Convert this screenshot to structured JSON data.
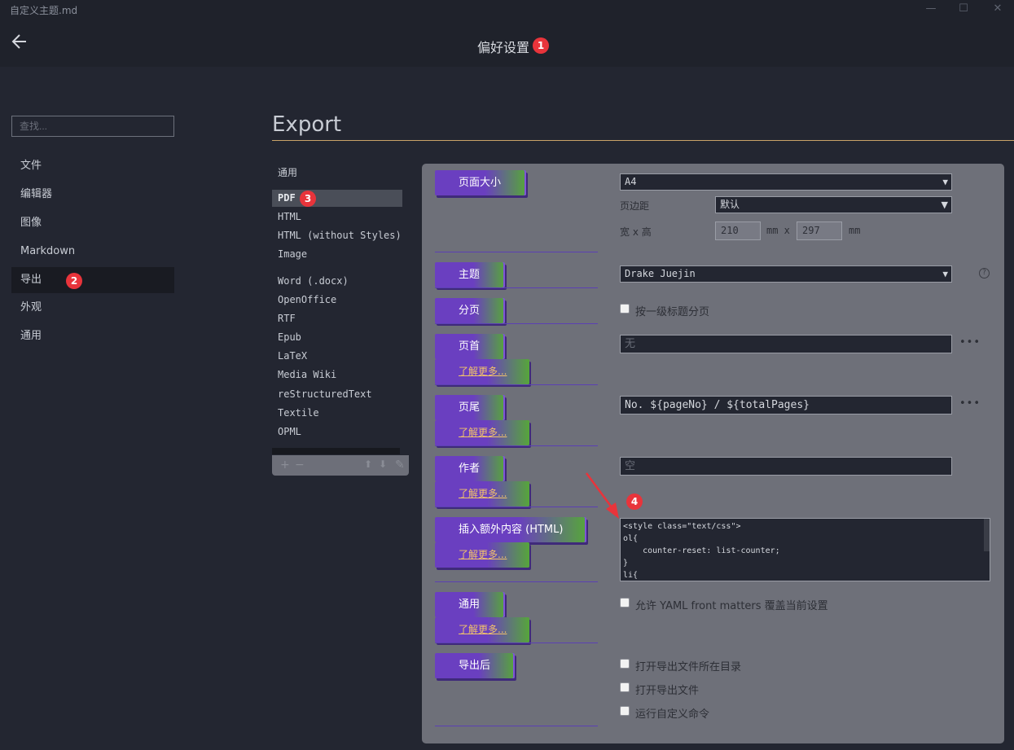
{
  "window": {
    "title": "自定义主题.md",
    "minimize": "—",
    "maximize": "☐",
    "close": "✕"
  },
  "header": {
    "title": "偏好设置"
  },
  "annotations": [
    "1",
    "2",
    "3",
    "4"
  ],
  "sidebar": {
    "search_placeholder": "查找...",
    "items": [
      {
        "label": "文件"
      },
      {
        "label": "编辑器"
      },
      {
        "label": "图像"
      },
      {
        "label": "Markdown"
      },
      {
        "label": "导出",
        "active": true
      },
      {
        "label": "外观"
      },
      {
        "label": "通用"
      }
    ]
  },
  "export": {
    "title": "Export"
  },
  "formats": {
    "items": [
      "通用",
      "PDF",
      "HTML",
      "HTML (without Styles)",
      "Image",
      "Word (.docx)",
      "OpenOffice",
      "RTF",
      "Epub",
      "LaTeX",
      "Media Wiki",
      "reStructuredText",
      "Textile",
      "OPML"
    ],
    "active": "PDF",
    "toolbar": {
      "add": "+",
      "remove": "−",
      "up": "⬆",
      "down": "⬇",
      "edit": "✎"
    }
  },
  "settings": {
    "page_size": {
      "label": "页面大小",
      "value": "A4",
      "margin_label": "页边距",
      "margin_value": "默认",
      "wh_label": "宽 x 高",
      "width": "210",
      "height": "297",
      "unit1": "mm x",
      "unit2": "mm"
    },
    "theme": {
      "label": "主题",
      "value": "Drake Juejin"
    },
    "paging": {
      "label": "分页",
      "option": "按一级标题分页"
    },
    "header_opt": {
      "label": "页首",
      "placeholder": "无",
      "learn_more": "了解更多..."
    },
    "footer_opt": {
      "label": "页尾",
      "value": "No. ${pageNo} / ${totalPages}",
      "learn_more": "了解更多..."
    },
    "author": {
      "label": "作者",
      "placeholder": "空",
      "learn_more": "了解更多..."
    },
    "extra_html": {
      "label": "插入额外内容 (HTML)",
      "learn_more": "了解更多...",
      "code": "<style class=\"text/css\">\nol{\n    counter-reset: list-counter;\n}\nli{"
    },
    "general": {
      "label": "通用",
      "option": "允许 YAML front matters 覆盖当前设置",
      "learn_more": "了解更多..."
    },
    "after_export": {
      "label": "导出后",
      "options": [
        "打开导出文件所在目录",
        "打开导出文件",
        "运行自定义命令"
      ]
    }
  }
}
